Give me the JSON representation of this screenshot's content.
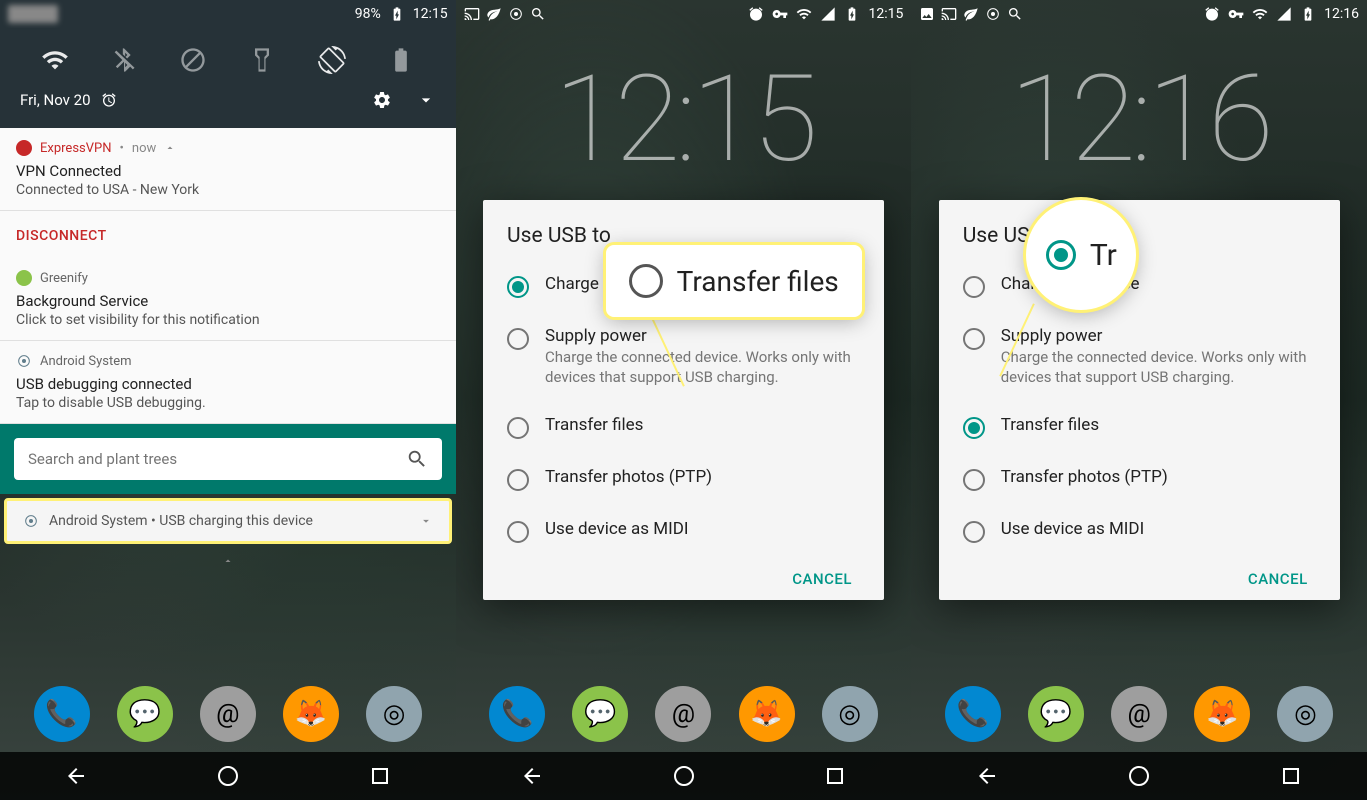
{
  "phone1": {
    "status": {
      "battery": "98%",
      "time": "12:15"
    },
    "date": "Fri, Nov 20",
    "notifications": {
      "vpn": {
        "app": "ExpressVPN",
        "time": "now",
        "title": "VPN Connected",
        "body": "Connected to USA - New York",
        "action": "DISCONNECT"
      },
      "greenify": {
        "app": "Greenify",
        "title": "Background Service",
        "body": "Click to set visibility for this notification"
      },
      "system": {
        "app": "Android System",
        "title": "USB debugging connected",
        "body": "Tap to disable USB debugging."
      },
      "usb": {
        "text": "Android System • USB charging this device"
      }
    },
    "search_placeholder": "Search and plant trees"
  },
  "phone2": {
    "status": {
      "time": "12:15"
    },
    "clock": "12:15",
    "dialog": {
      "title": "Use USB to",
      "options": [
        {
          "label": "Charge this device",
          "selected": true
        },
        {
          "label": "Supply power",
          "sub": "Charge the connected device. Works only with devices that support USB charging."
        },
        {
          "label": "Transfer files"
        },
        {
          "label": "Transfer photos (PTP)"
        },
        {
          "label": "Use device as MIDI"
        }
      ],
      "cancel": "CANCEL"
    },
    "callout": "Transfer files"
  },
  "phone3": {
    "status": {
      "time": "12:16"
    },
    "clock": "12:16",
    "dialog": {
      "title": "Use USB to",
      "options": [
        {
          "label": "Charge this device"
        },
        {
          "label": "Supply power",
          "sub": "Charge the connected device. Works only with devices that support USB charging."
        },
        {
          "label": "Transfer files",
          "selected": true
        },
        {
          "label": "Transfer photos (PTP)"
        },
        {
          "label": "Use device as MIDI"
        }
      ],
      "cancel": "CANCEL"
    },
    "callout": "Tr"
  }
}
